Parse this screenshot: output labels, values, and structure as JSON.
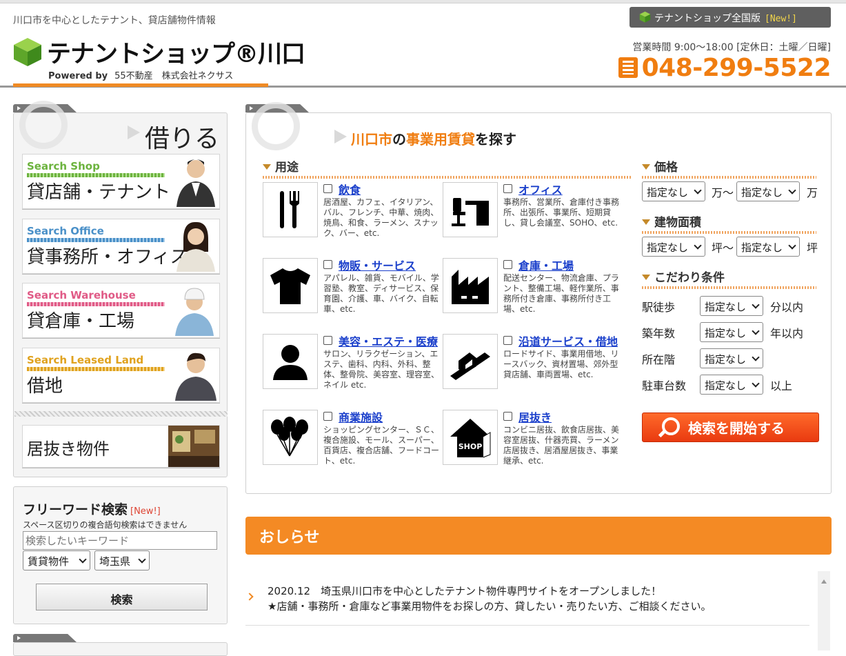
{
  "header": {
    "tagline": "川口市を中心としたテナント、貸店舗物件情報",
    "logo": "テナントショップ®川口",
    "powered_by": "Powered by",
    "powered_company": "55不動産　株式会社ネクサス",
    "national_badge": "テナントショップ全国版",
    "national_new": "[New!]",
    "hours": "営業時間 9:00～18:00 [定休日：土曜／日曜]",
    "phone": "048-299-5522"
  },
  "left": {
    "rent_title": "借りる",
    "cards": [
      {
        "en": "Search Shop",
        "jp": "貸店舗・テナント",
        "color": "#6cb33e"
      },
      {
        "en": "Search Office",
        "jp": "貸事務所・オフィス",
        "color": "#4a90c8"
      },
      {
        "en": "Search Warehouse",
        "jp": "貸倉庫・工場",
        "color": "#e05a86"
      },
      {
        "en": "Search Leased Land",
        "jp": "借地",
        "color": "#e0a21e"
      }
    ],
    "inuki": "居抜き物件",
    "free": {
      "title": "フリーワード検索",
      "new": "[New!]",
      "note": "スペース区切りの複合語句検索はできません",
      "placeholder": "検索したいキーワード",
      "type_value": "賃貸物件",
      "pref_value": "埼玉県",
      "button": "検索"
    }
  },
  "search": {
    "title_city": "川口市",
    "title_no": "の",
    "title_main": "事業用賃貸",
    "title_end": "を探す",
    "use_heading": "用途",
    "uses": [
      {
        "label": "飲食",
        "icon": "cutlery-icon",
        "desc": "居酒屋、カフェ、イタリアン、バル、フレンチ、中華、焼肉、焼鳥、和食、ラーメン、スナック、バー、etc."
      },
      {
        "label": "オフィス",
        "icon": "office-desk-icon",
        "desc": "事務所、営業所、倉庫付き事務所、出張所、事業所、短期貸し、貸し会議室、SOHO、etc."
      },
      {
        "label": "物販・サービス",
        "icon": "tshirt-icon",
        "desc": "アパレル、雑貨、モバイル、学習塾、教室、ディサービス、保育園、介護、車、バイク、自転車、etc."
      },
      {
        "label": "倉庫・工場",
        "icon": "factory-icon",
        "desc": "配送センター、物流倉庫、プラント、整備工場、軽作業所、事務所付き倉庫、事務所付き工場、etc."
      },
      {
        "label": "美容・エステ・医療",
        "icon": "person-icon",
        "desc": "サロン、リラクゼーション、エステ、歯科、内科、外科、整体、整骨院、美容室、理容室、ネイル etc."
      },
      {
        "label": "沿道サービス・借地",
        "icon": "roadside-icon",
        "desc": "ロードサイド、事業用借地、リースバック、資材置場、郊外型貸店舗、車両置場、etc."
      },
      {
        "label": "商業施設",
        "icon": "balloons-icon",
        "desc": "ショッピングセンター、ＳＣ、複合施設、モール、スーパー、百貨店、複合店舗、フードコート、etc."
      },
      {
        "label": "居抜き",
        "icon": "shop-house-icon",
        "desc": "コンビニ居抜、飲食店居抜、美容室居抜、什器売買、ラーメン店居抜き、居酒屋居抜き、事業継承、etc."
      }
    ],
    "price_heading": "価格",
    "area_heading": "建物面積",
    "cond_heading": "こだわり条件",
    "unset": "指定なし",
    "man_from": "万～",
    "man": "万",
    "tsubo_from": "坪～",
    "tsubo": "坪",
    "conditions": [
      {
        "label": "駅徒歩",
        "suffix": "分以内"
      },
      {
        "label": "築年数",
        "suffix": "年以内"
      },
      {
        "label": "所在階",
        "suffix": ""
      },
      {
        "label": "駐車台数",
        "suffix": "以上"
      }
    ],
    "start_button": "検索を開始する"
  },
  "news": {
    "heading": "おしらせ",
    "line1": "2020.12　埼玉県川口市を中心としたテナント物件専門サイトをオープンしました！",
    "line2": "★店舗・事務所・倉庫など事業用物件をお探しの方、貸したい・売りたい方、ご相談ください。"
  }
}
